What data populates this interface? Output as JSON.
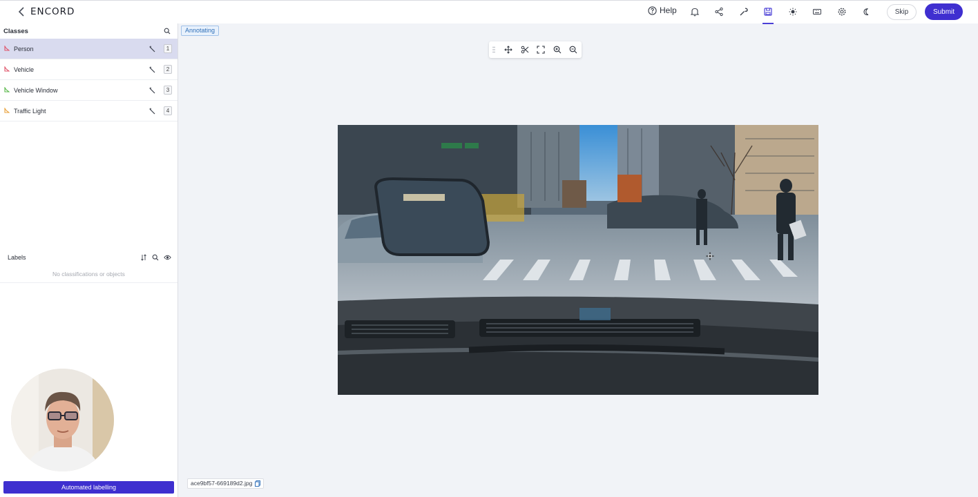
{
  "header": {
    "logo_text": "ENCORD",
    "help_label": "Help",
    "skip_label": "Skip",
    "submit_label": "Submit",
    "toolbar_icons": [
      "bell-icon",
      "share-icon",
      "wrench-icon",
      "save-icon",
      "sun-icon",
      "keyboard-icon",
      "gear-icon",
      "moon-icon"
    ],
    "active_icon": "save-icon",
    "accent_color": "#3f2fd0"
  },
  "sidebar": {
    "classes_title": "Classes",
    "classes": [
      {
        "label": "Person",
        "key": "1",
        "color": "#e0556b",
        "selected": true
      },
      {
        "label": "Vehicle",
        "key": "2",
        "color": "#e0556b",
        "selected": false
      },
      {
        "label": "Vehicle Window",
        "key": "3",
        "color": "#59b84a",
        "selected": false
      },
      {
        "label": "Traffic Light",
        "key": "4",
        "color": "#e9a13b",
        "selected": false
      }
    ],
    "labels_title": "Labels",
    "labels_empty": "No classifications or objects",
    "automated_button": "Automated labelling"
  },
  "main": {
    "status": "Annotating",
    "canvas_tools": [
      "move-icon",
      "scissors-icon",
      "fit-screen-icon",
      "zoom-in-icon",
      "zoom-out-icon"
    ],
    "filename": "ace9bf57-669189d2.jpg"
  }
}
